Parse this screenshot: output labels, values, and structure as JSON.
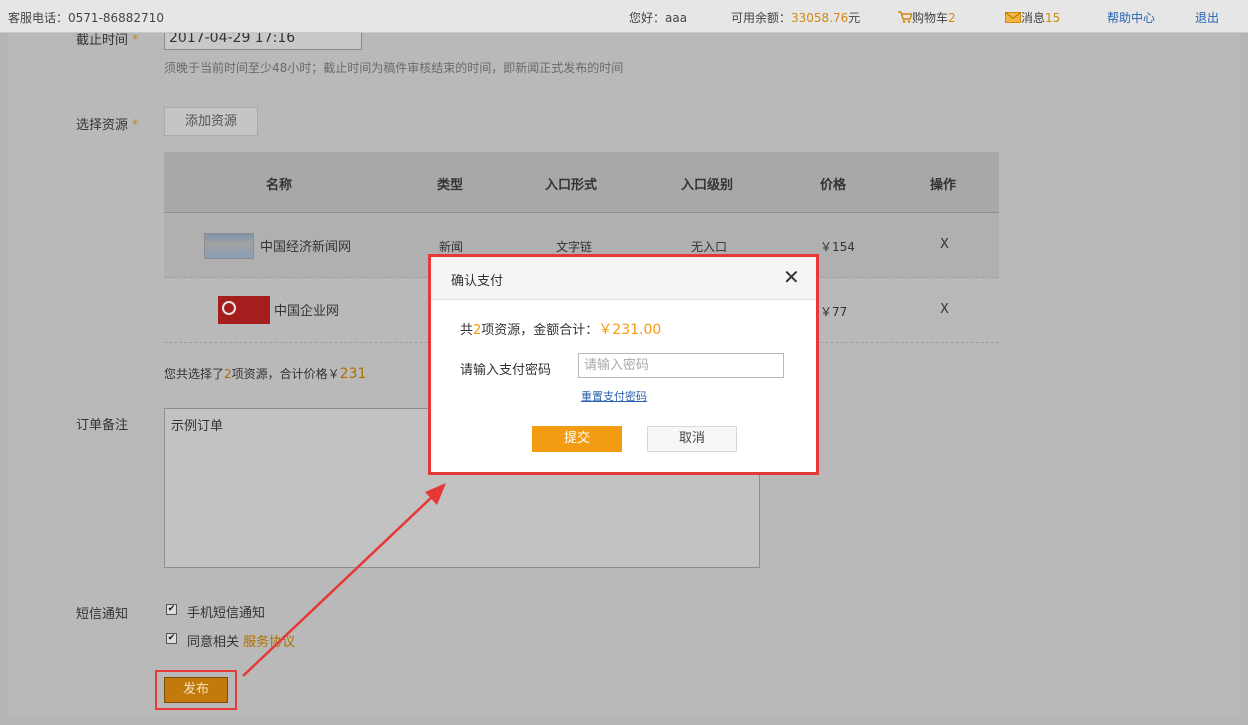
{
  "topbar": {
    "phone": "客服电话：0571-86882710",
    "greeting": "您好：aaa",
    "balance_label": "可用余额：",
    "balance_value": "33058.76",
    "balance_unit": "元",
    "cart_label": "购物车",
    "cart_count": "2",
    "msg_label": "消息",
    "msg_count": "15",
    "help": "帮助中心",
    "logout": "退出"
  },
  "form": {
    "deadline_label": "截止时间",
    "required_mark": "*",
    "deadline_value": "2017-04-29 17:16",
    "deadline_hint": "须晚于当前时间至少48小时；截止时间为稿件审核结束的时间，即新闻正式发布的时间",
    "resource_label": "选择资源",
    "add_resource": "添加资源",
    "table": {
      "headers": [
        "名称",
        "类型",
        "入口形式",
        "入口级别",
        "价格",
        "操作"
      ],
      "rows": [
        {
          "name": "中国经济新闻网",
          "type": "新闻",
          "entry_form": "文字链",
          "entry_level": "无入口",
          "price": "￥154",
          "op": "X"
        },
        {
          "name": "中国企业网",
          "type": "",
          "entry_form": "",
          "entry_level": "",
          "price": "￥77",
          "op": "X"
        }
      ]
    },
    "summary_prefix": "您共选择了",
    "summary_count": "2",
    "summary_mid": "项资源，合计价格￥",
    "summary_total": "231",
    "note_label": "订单备注",
    "note_value": "示例订单",
    "sms_label": "短信通知",
    "sms_option": "手机短信通知",
    "agree_option": "同意相关",
    "terms_link": "服务协议",
    "publish": "发布"
  },
  "modal": {
    "title": "确认支付",
    "summary_a": "共",
    "summary_count": "2",
    "summary_b": "项资源，金额合计：",
    "amount": "￥231.00",
    "pwd_label": "请输入支付密码",
    "pwd_placeholder": "请输入密码",
    "reset": "重置支付密码",
    "submit": "提交",
    "cancel": "取消"
  },
  "colors": {
    "accent": "#f39c12",
    "highlight_box": "#e53935",
    "link": "#2a62b0"
  }
}
